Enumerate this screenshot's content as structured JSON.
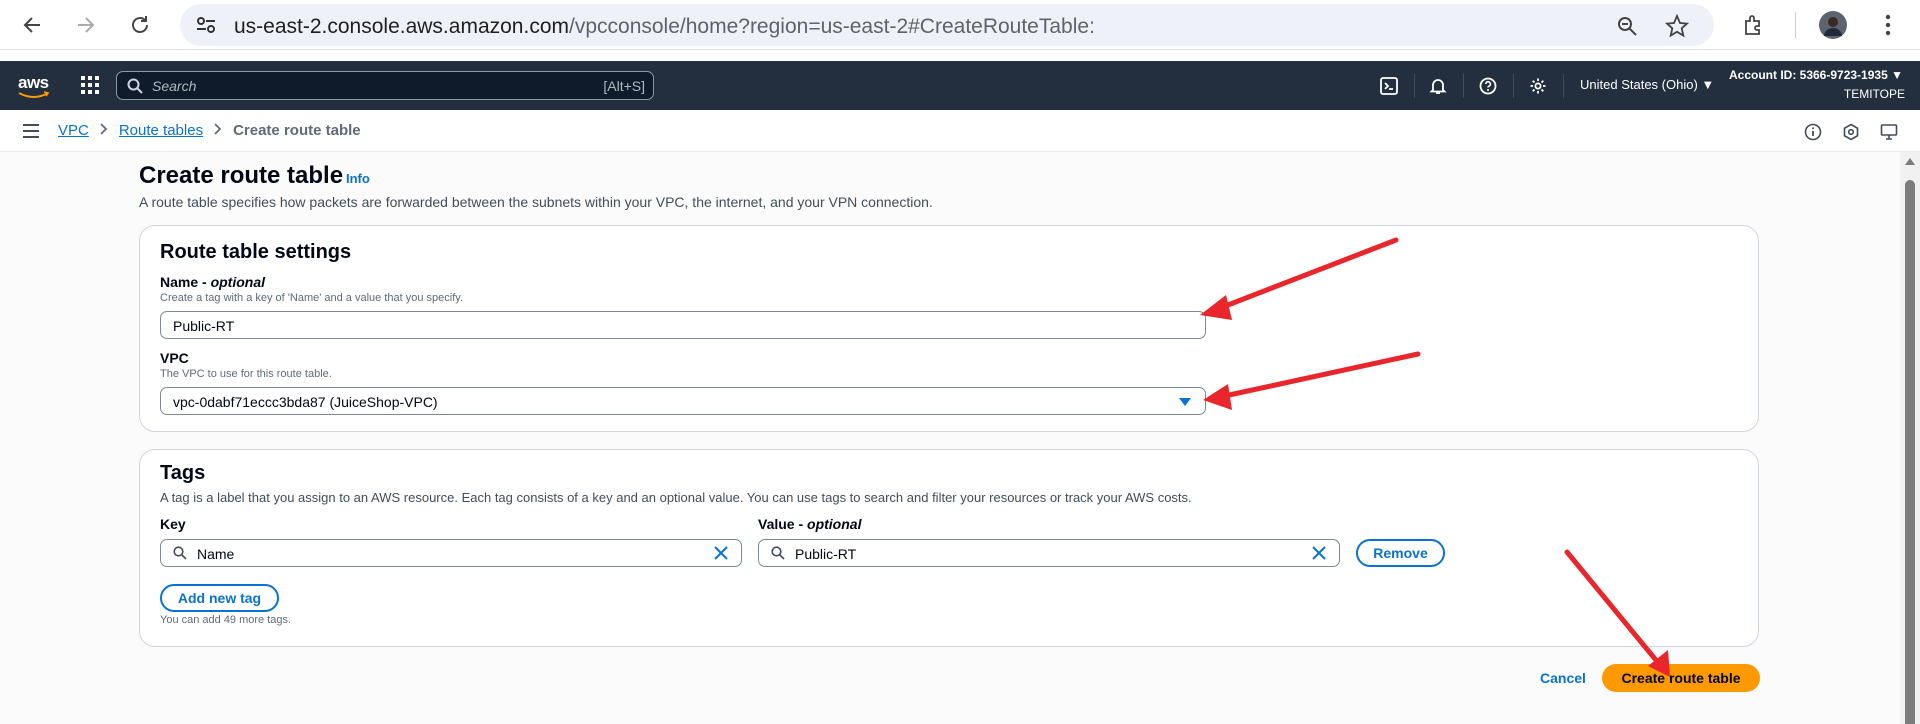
{
  "browser": {
    "url_host": "us-east-2.console.aws.amazon.com",
    "url_path": "/vpcconsole/home?region=us-east-2#CreateRouteTable:"
  },
  "aws_nav": {
    "logo": "aws",
    "search_placeholder": "Search",
    "search_shortcut": "[Alt+S]",
    "region": "United States (Ohio) ▼",
    "account_id": "Account ID: 5366-9723-1935 ▼",
    "account_name": "TEMITOPE"
  },
  "breadcrumb": {
    "items": [
      "VPC",
      "Route tables"
    ],
    "current": "Create route table"
  },
  "page": {
    "title": "Create route table",
    "info_link": "Info",
    "description": "A route table specifies how packets are forwarded between the subnets within your VPC, the internet, and your VPN connection."
  },
  "settings": {
    "title": "Route table settings",
    "name_label": "Name - ",
    "name_optional": "optional",
    "name_hint": "Create a tag with a key of 'Name' and a value that you specify.",
    "name_value": "Public-RT",
    "vpc_label": "VPC",
    "vpc_hint": "The VPC to use for this route table.",
    "vpc_value": "vpc-0dabf71eccc3bda87 (JuiceShop-VPC)"
  },
  "tags": {
    "title": "Tags",
    "description": "A tag is a label that you assign to an AWS resource. Each tag consists of a key and an optional value. You can use tags to search and filter your resources or track your AWS costs.",
    "key_label": "Key",
    "value_label": "Value - ",
    "value_optional": "optional",
    "key_value": "Name",
    "value_value": "Public-RT",
    "remove_label": "Remove",
    "add_label": "Add new tag",
    "remaining": "You can add 49 more tags."
  },
  "footer": {
    "cancel_label": "Cancel",
    "create_label": "Create route table"
  },
  "colors": {
    "aws_nav_bg": "#232f3e",
    "link_blue": "#0972d3",
    "primary_orange": "#ff9900",
    "annotation_red": "#e8262b"
  }
}
